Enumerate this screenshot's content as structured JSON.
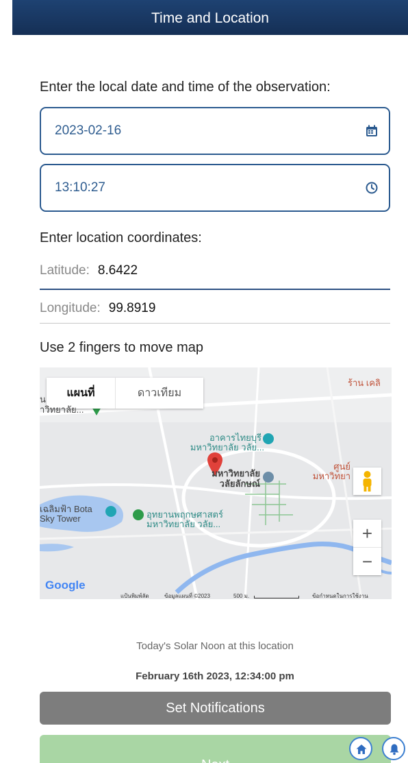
{
  "header": {
    "title": "Time and Location"
  },
  "datetime": {
    "prompt": "Enter the local date and time of the observation:",
    "date_value": "2023-02-16",
    "time_value": "13:10:27",
    "date_icon": "calendar-icon",
    "time_icon": "clock-icon"
  },
  "location": {
    "prompt": "Enter location coordinates:",
    "latitude_label": "Latitude:",
    "latitude_value": "8.6422",
    "longitude_label": "Longitude:",
    "longitude_value": "99.8919"
  },
  "map": {
    "hint": "Use 2 fingers to move map",
    "type_map": "แผนที่",
    "type_satellite": "ดาวเทียม",
    "labels": {
      "top_left_a": "น",
      "top_left_b": "าวิทยาลัย...",
      "top_right": "ร้าน เคลิ",
      "hall_a": "อาคารไทยบุรี",
      "hall_b": "มหาวิทยาลัย วลัย...",
      "university_a": "มหาวิทยาลัย",
      "university_b": "วลัยลักษณ์",
      "center_a": "ศูนย์",
      "center_b": "มหาวิทยา",
      "tower_a": "เฉลิมฟ้า Bota",
      "tower_b": "Sky Tower",
      "park_a": "อุทยานพฤกษศาสตร์",
      "park_b": "มหาวิทยาลัย วลัย..."
    },
    "zoom_in": "+",
    "zoom_out": "−",
    "google": "Google",
    "shortcuts": "แป้นพิมพ์ลัด",
    "map_data": "ข้อมูลแผนที่ ©2023",
    "scale": "500 ม.",
    "terms": "ข้อกำหนดในการใช้งาน",
    "colors": {
      "water": "#a8c7f0",
      "park": "#6fbf79",
      "road": "#ffffff",
      "marker": "#e0413a"
    }
  },
  "solar": {
    "label": "Today's Solar Noon at this location",
    "value": "February 16th 2023, 12:34:00 pm"
  },
  "buttons": {
    "notifications": "Set Notifications",
    "next": "Next"
  },
  "fabs": {
    "home_icon": "home-icon",
    "bell_icon": "bell-icon"
  },
  "colors": {
    "primary": "#2b5a8f",
    "header": "#1e4272",
    "next_button": "#a9d6a4",
    "notify_button": "#7d7d7d"
  }
}
